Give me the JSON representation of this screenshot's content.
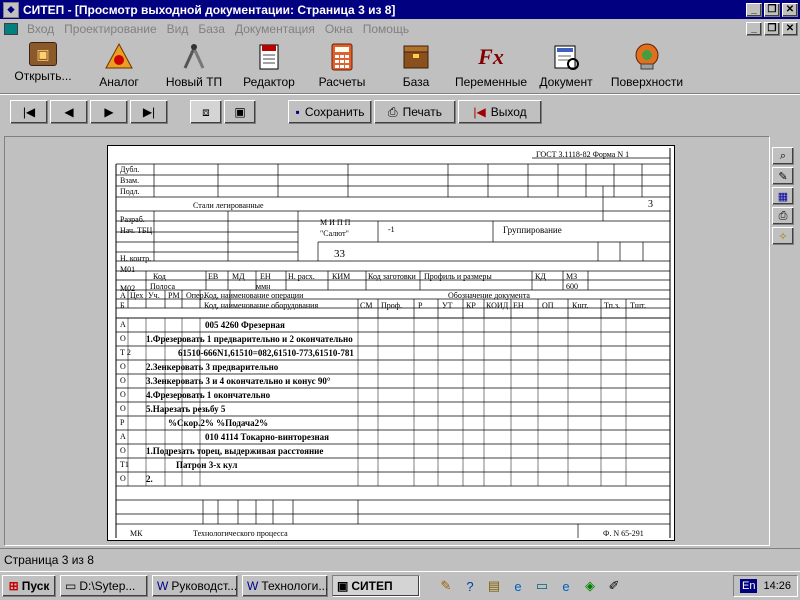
{
  "window": {
    "title": "СИТЕП - [Просмотр выходной документации:  Страница 3 из 8]"
  },
  "menu": [
    "Вход",
    "Проектирование",
    "Вид",
    "База",
    "Документация",
    "Окна",
    "Помощь"
  ],
  "toolbar": [
    {
      "label": "Открыть...",
      "icon": "open-icon"
    },
    {
      "label": "Аналог",
      "icon": "analog-icon"
    },
    {
      "label": "Новый ТП",
      "icon": "new-tp-icon"
    },
    {
      "label": "Редактор",
      "icon": "editor-icon"
    },
    {
      "label": "Расчеты",
      "icon": "calculator-icon"
    },
    {
      "label": "База",
      "icon": "database-icon"
    },
    {
      "label": "Переменные",
      "icon": "fx-icon"
    },
    {
      "label": "Документ",
      "icon": "document-icon"
    },
    {
      "label": "Поверхности",
      "icon": "surfaces-icon"
    }
  ],
  "nav": {
    "save": "Сохранить",
    "print": "Печать",
    "exit": "Выход"
  },
  "doc": {
    "gost": "ГОСТ 3.1118-82  Форма N 1",
    "side_labels": [
      "Дубл.",
      "Взам.",
      "Подл."
    ],
    "material": "Стали легированные",
    "page_num": "3",
    "sign_labels": [
      "Разраб.",
      "Нач. ТБЦ",
      "Н. контр."
    ],
    "org": "М И П П",
    "org2": "\"Салют\"",
    "doc_code": "-1",
    "group": "Группирование",
    "num33": "33",
    "m01": "М01",
    "m02": "М02",
    "hdr1": [
      "Код",
      "ЕВ",
      "МД",
      "ЕН",
      "Н. расх.",
      "КИМ",
      "Код заготовки",
      "Профиль и размеры",
      "КД",
      "МЗ"
    ],
    "hdr2": [
      "Полоса",
      "ммн",
      "600"
    ],
    "hdr_a": [
      "А",
      "Цех",
      "Уч.",
      "РМ",
      "Опер.",
      "Код, наименование операции",
      "Обозначение документа"
    ],
    "hdr_b": [
      "Б",
      "Код, наименование оборудования",
      "СМ",
      "Проф.",
      "Р",
      "УТ",
      "КР",
      "КОИД",
      "ЕН",
      "ОП",
      "Кшт.",
      "Тп.з.",
      "Тшт."
    ],
    "rows": [
      {
        "k": "А",
        "t": "005    4260 Фрезерная",
        "x": 97
      },
      {
        "k": "О",
        "t": "1.Фрезеровать 1 предварительно и 2 окончательно",
        "x": 38
      },
      {
        "k": "Т 2",
        "t": "61510-666N1,61510=082,61510-773,61510-781",
        "x": 70
      },
      {
        "k": "О",
        "t": "2.Зенкеровать 3 предварительно",
        "x": 38
      },
      {
        "k": "О",
        "t": "3.Зенкеровать 3 и 4 окончательно и конус 90°",
        "x": 38
      },
      {
        "k": "О",
        "t": "4.Фрезеровать 1 окончательно",
        "x": 38
      },
      {
        "k": "О",
        "t": "5.Нарезать резьбу 5",
        "x": 38
      },
      {
        "k": "Р",
        "t": "%Скор.2%   %Подача2%",
        "x": 60
      },
      {
        "k": "А",
        "t": "010    4114 Токарно-винторезная",
        "x": 97
      },
      {
        "k": "О",
        "t": "1.Подрезать торец, выдерживая расстояние",
        "x": 38
      },
      {
        "k": "Т1",
        "t": "Патрон 3-х кул",
        "x": 68
      },
      {
        "k": "О",
        "t": "2.",
        "x": 38
      }
    ],
    "footer_code": "МК",
    "footer_title": "Технологического процесса",
    "footer_form": "Ф. N 65-291"
  },
  "status": "Страница 3 из 8",
  "taskbar": {
    "start": "Пуск",
    "tasks": [
      "D:\\Sytep...",
      "Руководст...",
      "Технологи...",
      "СИТЕП"
    ],
    "lang": "En",
    "clock": "14:26"
  }
}
